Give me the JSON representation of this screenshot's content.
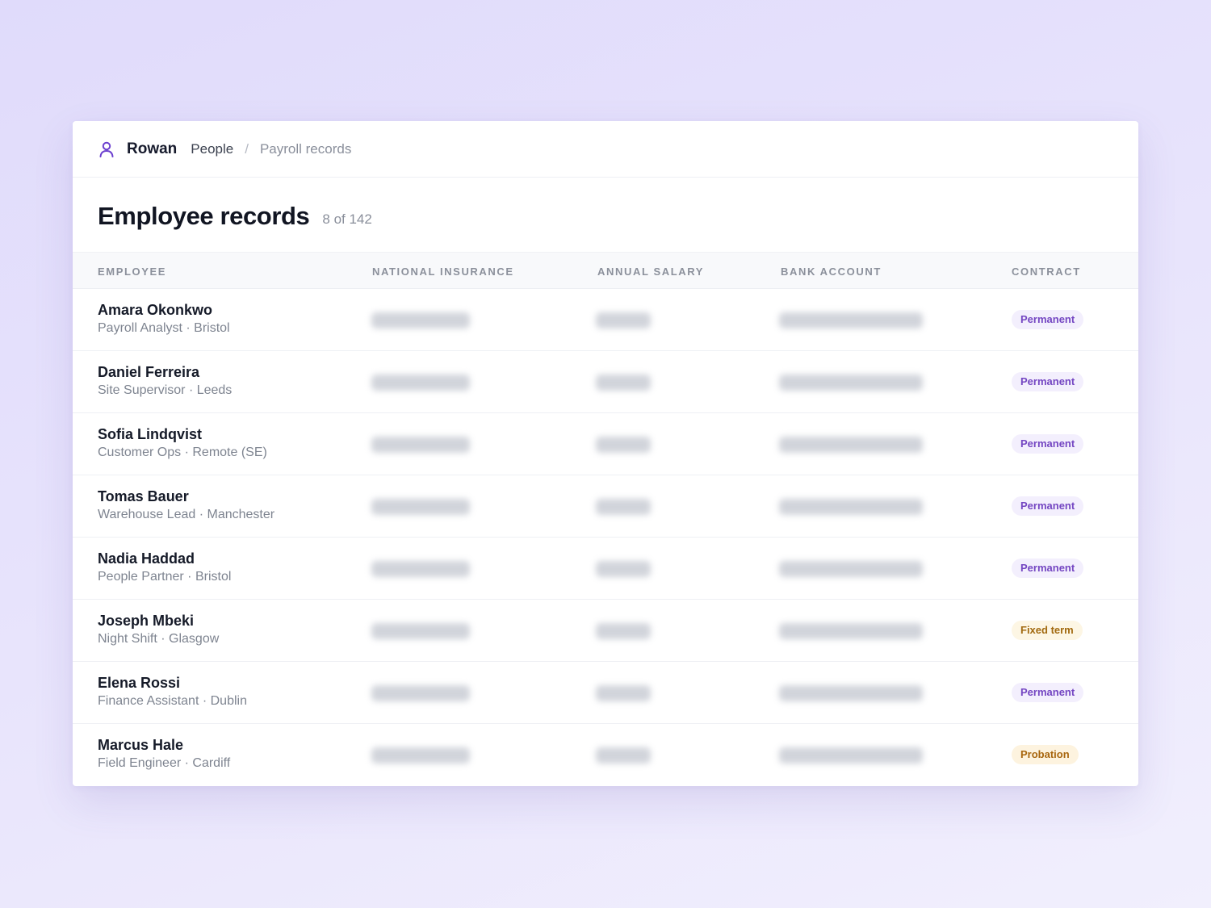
{
  "app": {
    "brand": "Rowan",
    "brand_icon": "user-icon",
    "accent_color": "#6b3fcf"
  },
  "breadcrumb": {
    "section": "People",
    "separator": "/",
    "current": "Payroll records"
  },
  "page": {
    "title": "Employee records",
    "count": "8 of 142"
  },
  "table": {
    "columns": [
      "Employee",
      "National insurance",
      "Annual salary",
      "Bank account",
      "Contract"
    ],
    "rows": [
      {
        "name": "Amara Okonkwo",
        "meta": "Payroll Analyst · Bristol",
        "contract": "Permanent",
        "contract_kind": "permanent"
      },
      {
        "name": "Daniel Ferreira",
        "meta": "Site Supervisor · Leeds",
        "contract": "Permanent",
        "contract_kind": "permanent"
      },
      {
        "name": "Sofia Lindqvist",
        "meta": "Customer Ops · Remote (SE)",
        "contract": "Permanent",
        "contract_kind": "permanent"
      },
      {
        "name": "Tomas Bauer",
        "meta": "Warehouse Lead · Manchester",
        "contract": "Permanent",
        "contract_kind": "permanent"
      },
      {
        "name": "Nadia Haddad",
        "meta": "People Partner · Bristol",
        "contract": "Permanent",
        "contract_kind": "permanent"
      },
      {
        "name": "Joseph Mbeki",
        "meta": "Night Shift · Glasgow",
        "contract": "Fixed term",
        "contract_kind": "fixed"
      },
      {
        "name": "Elena Rossi",
        "meta": "Finance Assistant · Dublin",
        "contract": "Permanent",
        "contract_kind": "permanent"
      },
      {
        "name": "Marcus Hale",
        "meta": "Field Engineer · Cardiff",
        "contract": "Probation",
        "contract_kind": "probation"
      }
    ]
  }
}
